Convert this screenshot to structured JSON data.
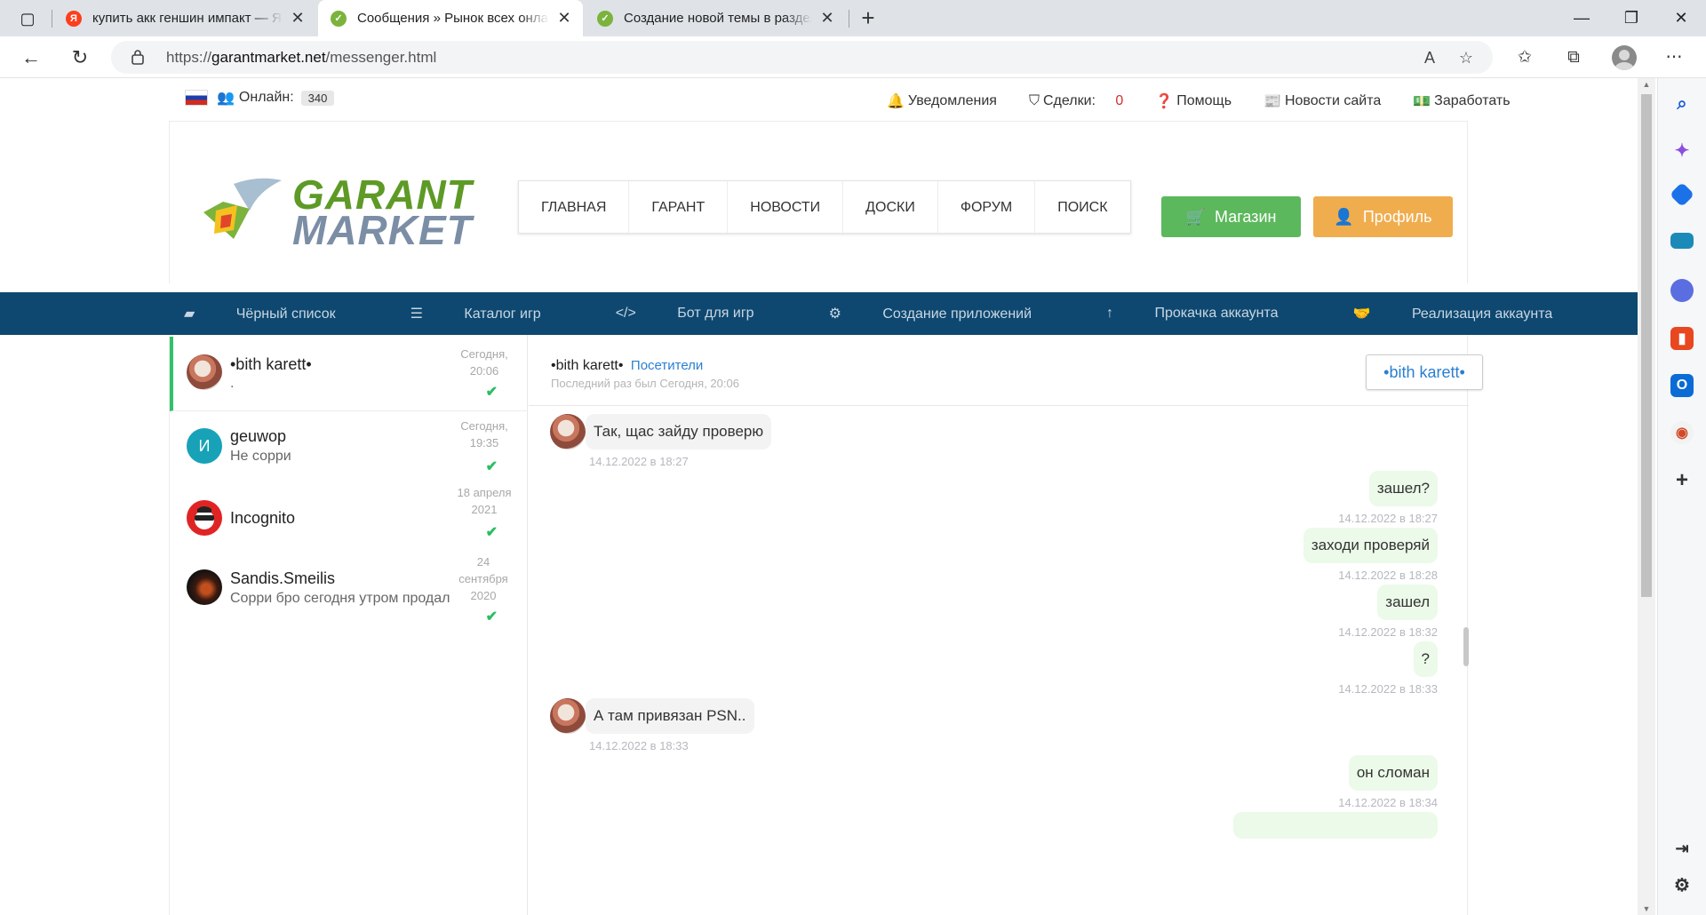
{
  "browser": {
    "tabs": [
      {
        "title": "купить акк геншин импакт — Яндекс",
        "favicon": "Я",
        "favicon_color": "#fc3f1d",
        "active": false
      },
      {
        "title": "Сообщения » Рынок всех онлайн игр",
        "favicon": "✓",
        "favicon_color": "#7bb33d",
        "active": true
      },
      {
        "title": "Создание новой темы в разделе",
        "favicon": "✓",
        "favicon_color": "#7bb33d",
        "active": false
      }
    ],
    "url_scheme": "https://",
    "url_host": "garantmarket.net",
    "url_path": "/messenger.html"
  },
  "site": {
    "online_label": "Онлайн:",
    "online_count": "340",
    "top_links": {
      "notifications": "Уведомления",
      "deals_label": "Сделки:",
      "deals_count": "0",
      "help": "Помощь",
      "news": "Новости сайта",
      "earn": "Заработать"
    },
    "logo": {
      "line1": "GARANT",
      "line2": "MARKET"
    },
    "main_nav": [
      "Главная",
      "Гарант",
      "Новости",
      "Доски",
      "Форум",
      "Поиск"
    ],
    "shop_button": "Магазин",
    "profile_button": "Профиль",
    "sub_nav": [
      "Чёрный список",
      "Каталог игр",
      "Бот для игр",
      "Создание приложений",
      "Прокачка аккаунта",
      "Реализация аккаунта"
    ]
  },
  "dialogs": [
    {
      "name": "•bith karett•",
      "preview": ".",
      "date": "Сегодня, 20:06",
      "read": true
    },
    {
      "name": "geuwop",
      "preview": "Не сорри",
      "date": "Сегодня, 19:35",
      "read": true,
      "initial": "И"
    },
    {
      "name": "Incognito",
      "preview": "",
      "date": "18 апреля 2021",
      "read": true
    },
    {
      "name": "Sandis.Smeilis",
      "preview": "Сорри бро сегодня утром продал",
      "date": "24 сентября 2020",
      "read": true
    }
  ],
  "chat": {
    "contact_name": "•bith karett•",
    "contact_group": "Посетители",
    "last_seen": "Последний раз был Сегодня, 20:06",
    "profile_button": "•bith karett•",
    "messages": [
      {
        "dir": "in",
        "text": "Так, щас зайду проверю",
        "time": "14.12.2022 в 18:27"
      },
      {
        "dir": "out",
        "text": "зашел?",
        "time": "14.12.2022 в 18:27"
      },
      {
        "dir": "out",
        "text": "заходи проверяй",
        "time": "14.12.2022 в 18:28"
      },
      {
        "dir": "out",
        "text": "зашел",
        "time": "14.12.2022 в 18:32"
      },
      {
        "dir": "out",
        "text": "?",
        "time": "14.12.2022 в 18:33"
      },
      {
        "dir": "in",
        "text": "А там привязан PSN..",
        "time": "14.12.2022 в 18:33"
      },
      {
        "dir": "out",
        "text": "он сломан",
        "time": "14.12.2022 в 18:34"
      }
    ]
  }
}
